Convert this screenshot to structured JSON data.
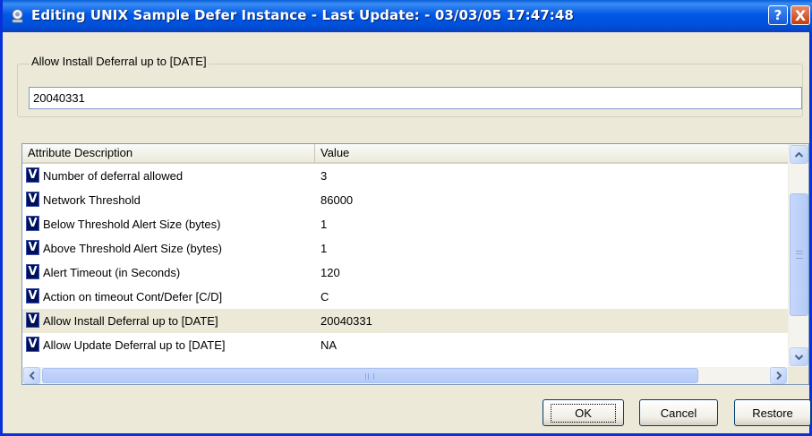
{
  "window": {
    "title": "Editing UNIX Sample Defer Instance - Last Update: - 03/03/05 17:47:48",
    "help_label": "?",
    "close_label": "X"
  },
  "group": {
    "legend": "Allow Install Deferral up to [DATE]",
    "value": "20040331"
  },
  "table": {
    "columns": [
      "Attribute Description",
      "Value"
    ],
    "row_icon": "V",
    "rows": [
      {
        "description": "Number of deferral allowed",
        "value": "3"
      },
      {
        "description": "Network Threshold",
        "value": "86000"
      },
      {
        "description": "Below Threshold Alert Size (bytes)",
        "value": "1"
      },
      {
        "description": "Above Threshold Alert Size (bytes)",
        "value": "1"
      },
      {
        "description": "Alert Timeout (in Seconds)",
        "value": "120"
      },
      {
        "description": "Action on timeout Cont/Defer [C/D]",
        "value": "C"
      },
      {
        "description": "Allow Install Deferral up to [DATE]",
        "value": "20040331",
        "selected": true
      },
      {
        "description": "Allow Update Deferral up to [DATE]",
        "value": "NA"
      }
    ]
  },
  "buttons": {
    "ok": "OK",
    "cancel": "Cancel",
    "restore": "Restore"
  },
  "colors": {
    "titlebar": "#0058e6",
    "selected_row": "#ece9d8",
    "icon_bg": "#00105a"
  }
}
